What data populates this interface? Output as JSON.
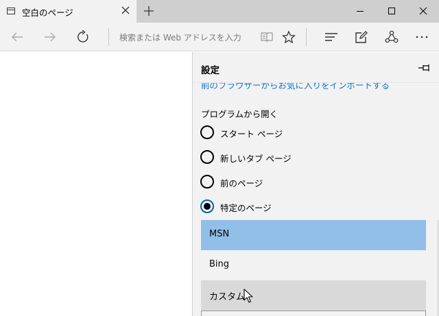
{
  "tab": {
    "title": "空白のページ"
  },
  "address_bar": {
    "placeholder": "検索または Web アドレスを入力"
  },
  "settings": {
    "title": "設定",
    "import_link": "前のブラウザーからお気に入りをインポートする",
    "open_with_label": "プログラムから開く",
    "options": [
      {
        "label": "スタート ページ",
        "selected": false
      },
      {
        "label": "新しいタブ ページ",
        "selected": false
      },
      {
        "label": "前のページ",
        "selected": false
      },
      {
        "label": "特定のページ",
        "selected": true
      }
    ],
    "dropdown": {
      "items": [
        "MSN",
        "Bing",
        "カスタム"
      ],
      "highlighted": "MSN",
      "hovered": "カスタム"
    }
  },
  "colors": {
    "accent_link": "#0e74c8",
    "selected_item": "#91bfe7",
    "hover_item": "#d9d9d9",
    "radio_selected_ring": "#0063b1"
  }
}
